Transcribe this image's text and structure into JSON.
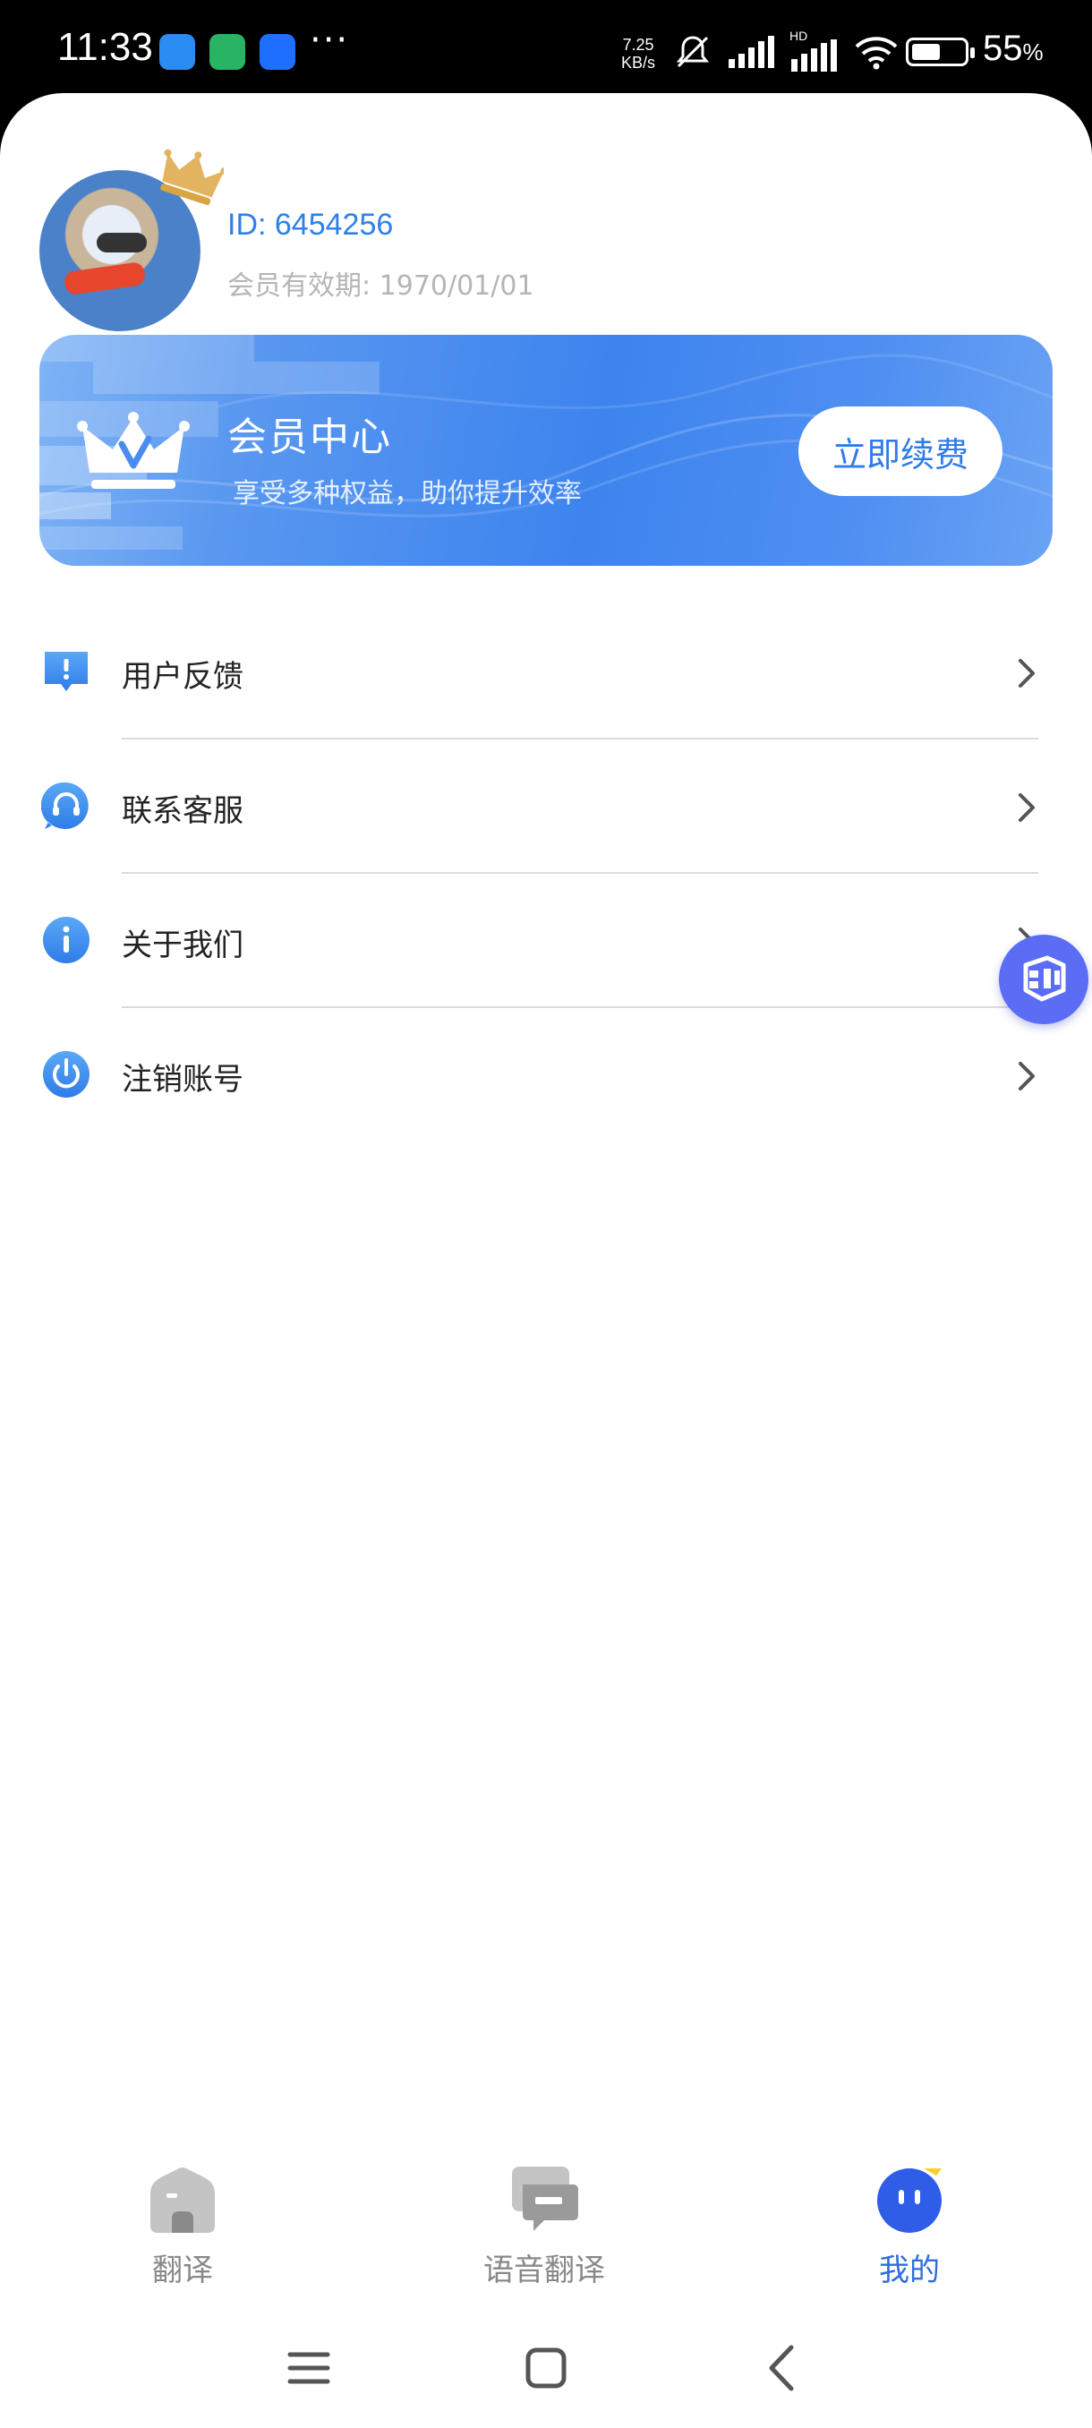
{
  "status_bar": {
    "time": "11:33",
    "more": "···",
    "net_speed_value": "7.25",
    "net_speed_unit": "KB/s",
    "network_type": "HD",
    "battery_percent": "55",
    "battery_suffix": "%",
    "battery_level": 0.55
  },
  "profile": {
    "id_text": "ID: 6454256",
    "expiry_text": "会员有效期: 1970/01/01"
  },
  "member_banner": {
    "title": "会员中心",
    "subtitle": "享受多种权益，助你提升效率",
    "renew_label": "立即续费"
  },
  "menu": {
    "items": [
      {
        "label": "用户反馈",
        "icon": "feedback-icon"
      },
      {
        "label": "联系客服",
        "icon": "headset-icon"
      },
      {
        "label": "关于我们",
        "icon": "info-icon"
      },
      {
        "label": "注销账号",
        "icon": "power-icon"
      }
    ]
  },
  "tabs": [
    {
      "label": "翻译",
      "icon": "home-icon",
      "active": false
    },
    {
      "label": "语音翻译",
      "icon": "chat-icon",
      "active": false
    },
    {
      "label": "我的",
      "icon": "profile-icon",
      "active": true
    }
  ],
  "colors": {
    "accent": "#2f6de0",
    "banner": "#3d84ee",
    "id_text": "#2f80e8"
  }
}
